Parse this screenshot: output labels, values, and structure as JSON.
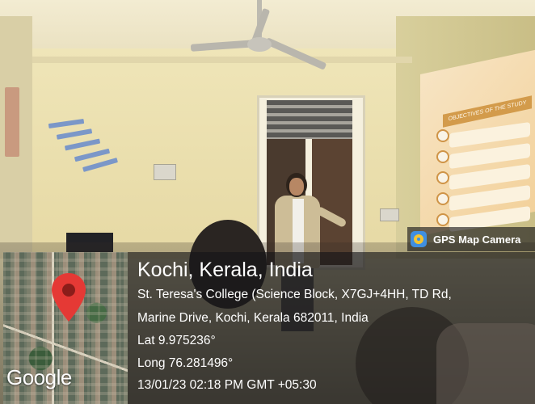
{
  "overlay": {
    "badge_label": "GPS Map Camera",
    "location_title": "Kochi, Kerala, India",
    "address_line1": "St. Teresa's College (Science Block, X7GJ+4HH, TD Rd,",
    "address_line2": "Marine Drive, Kochi, Kerala 682011, India",
    "latitude": "Lat 9.975236°",
    "longitude": "Long 76.281496°",
    "timestamp": "13/01/23 02:18 PM GMT +05:30",
    "map_brand": "Google"
  },
  "slide": {
    "title": "OBJECTIVES OF THE STUDY"
  },
  "colors": {
    "pin": "#e53935",
    "overlay_bg": "#141416",
    "projection": "#f2cf96",
    "wall": "#e8dcae"
  }
}
